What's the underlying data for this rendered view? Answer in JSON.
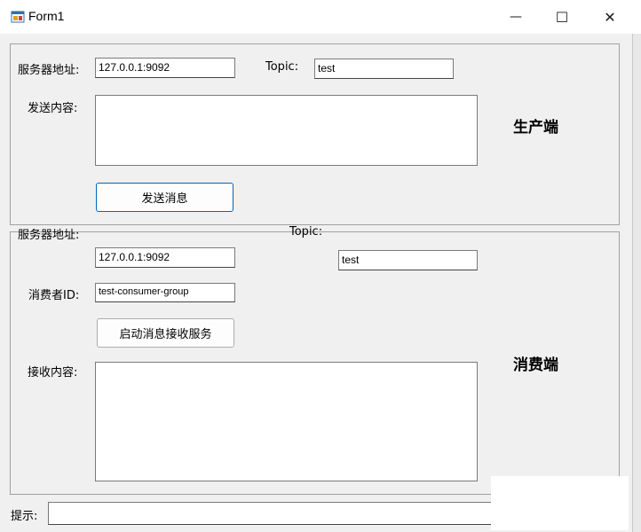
{
  "window": {
    "title": "Form1",
    "minimize_glyph": "—",
    "maximize_glyph": "☐",
    "close_glyph": "✕"
  },
  "producer": {
    "server_label": "服务器地址:",
    "server_value": "127.0.0.1:9092",
    "topic_label": "Topic:",
    "topic_value": "test",
    "content_label": "发送内容:",
    "content_value": "",
    "send_button": "发送消息",
    "section_title": "生产端"
  },
  "consumer": {
    "server_label": "服务器地址:",
    "server_value": "127.0.0.1:9092",
    "topic_label": "Topic:",
    "topic_value": "test",
    "consumer_id_label": "消费者ID:",
    "consumer_id_value": "test-consumer-group",
    "start_button": "启动消息接收服务",
    "receive_label": "接收内容:",
    "receive_value": "",
    "section_title": "消费端"
  },
  "status": {
    "hint_label": "提示:",
    "hint_value": ""
  },
  "colors": {
    "focus_border": "#0067c0",
    "group_border": "#a0a0a0",
    "form_bg": "#f0f0f0"
  }
}
